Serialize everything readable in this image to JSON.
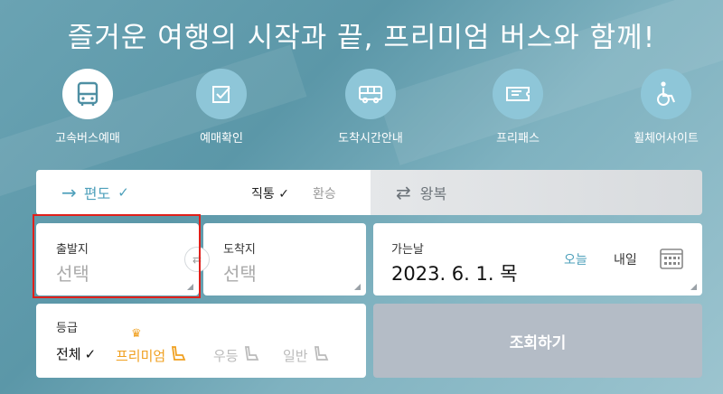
{
  "headline": "즐거운 여행의 시작과 끝, 프리미엄 버스와 함께!",
  "menu": [
    {
      "label": "고속버스예매",
      "icon": "bus-icon",
      "active": true
    },
    {
      "label": "예매확인",
      "icon": "checkbox-icon",
      "active": false
    },
    {
      "label": "도착시간안내",
      "icon": "bus-front-icon",
      "active": false
    },
    {
      "label": "프리패스",
      "icon": "ticket-icon",
      "active": false
    },
    {
      "label": "휠체어사이트",
      "icon": "wheelchair-icon",
      "active": false
    }
  ],
  "trip": {
    "oneway_label": "편도",
    "direct_label": "직통",
    "transfer_label": "환승",
    "roundtrip_label": "왕복"
  },
  "departure": {
    "label": "출발지",
    "value": "선택"
  },
  "arrival": {
    "label": "도착지",
    "value": "선택"
  },
  "date": {
    "label": "가는날",
    "value": "2023. 6. 1. 목",
    "today": "오늘",
    "tomorrow": "내일"
  },
  "grade": {
    "label": "등급",
    "options": [
      {
        "label": "전체",
        "selected": true
      },
      {
        "label": "프리미엄",
        "color": "#f0a020"
      },
      {
        "label": "우등"
      },
      {
        "label": "일반"
      }
    ]
  },
  "search_label": "조회하기",
  "colors": {
    "accent": "#4ea0bb",
    "premium": "#f0a020",
    "highlight": "#e0201b",
    "search_bg": "#b4bcc6"
  }
}
